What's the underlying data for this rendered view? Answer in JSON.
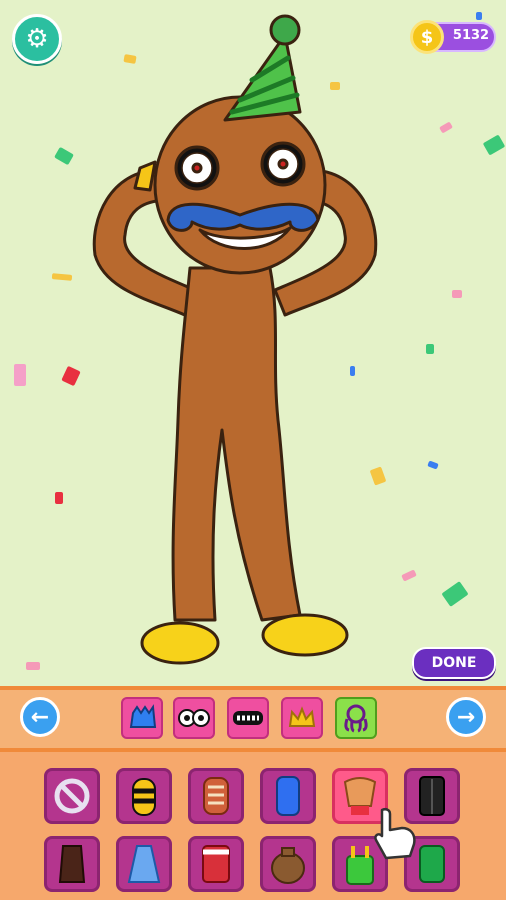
{
  "hud": {
    "settings_icon": "gear-icon",
    "coins": "5132",
    "coin_symbol": "$"
  },
  "done_button": "DONE",
  "character": {
    "name_icon": "mustache-character",
    "accessories": [
      "party-hat",
      "mustache",
      "yellow-shoes"
    ]
  },
  "categories": [
    {
      "icon": "blue-monster-icon",
      "selected": false
    },
    {
      "icon": "eyes-icon",
      "selected": false
    },
    {
      "icon": "teeth-icon",
      "selected": false
    },
    {
      "icon": "crown-icon",
      "selected": false
    },
    {
      "icon": "octopus-icon",
      "selected": true
    }
  ],
  "items": [
    {
      "icon": "none-icon",
      "selected": false
    },
    {
      "icon": "bee-outfit-icon",
      "selected": false
    },
    {
      "icon": "ribs-outfit-icon",
      "selected": false
    },
    {
      "icon": "blue-tank-icon",
      "selected": false
    },
    {
      "icon": "muscle-outfit-icon",
      "selected": true
    },
    {
      "icon": "black-vest-icon",
      "selected": false
    },
    {
      "icon": "brown-top-icon",
      "selected": false
    },
    {
      "icon": "blue-dress-icon",
      "selected": false
    },
    {
      "icon": "cake-dress-icon",
      "selected": false
    },
    {
      "icon": "sack-outfit-icon",
      "selected": false
    },
    {
      "icon": "green-overalls-icon",
      "selected": false
    },
    {
      "icon": "green-shirt-icon",
      "selected": false
    }
  ],
  "colors": {
    "background": "#e4f2c8",
    "accent_orange": "#f08a3a",
    "slot_purple": "#b4358e",
    "selected_pink": "#ff5a8a",
    "done_purple": "#6b2fc0"
  }
}
